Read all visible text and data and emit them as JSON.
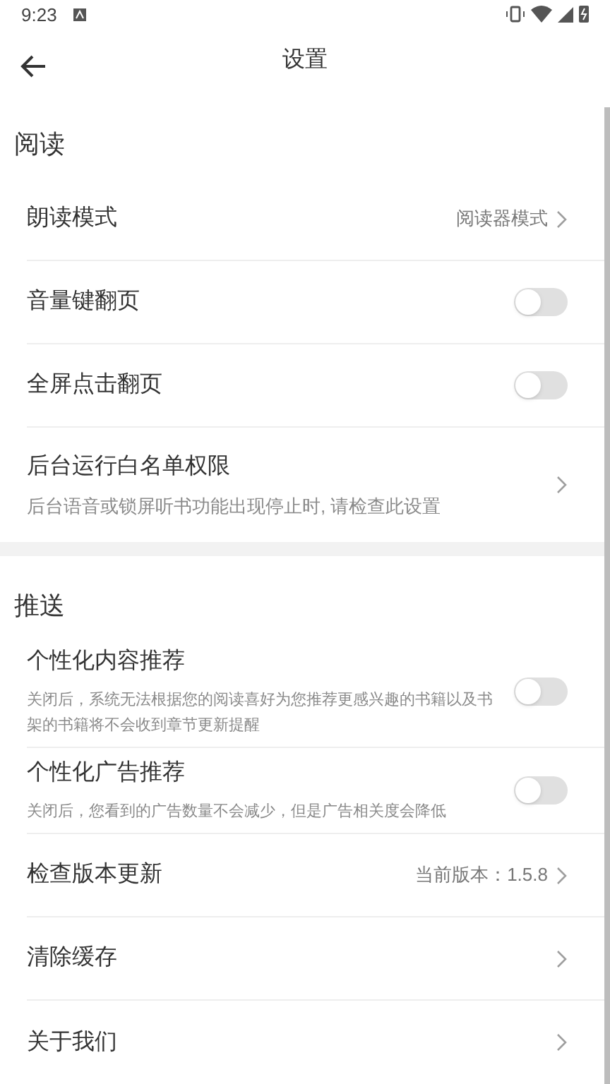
{
  "status_bar": {
    "time": "9:23"
  },
  "header": {
    "title": "设置"
  },
  "sections": [
    {
      "title": "阅读",
      "items": [
        {
          "kind": "link",
          "label": "朗读模式",
          "value": "阅读器模式"
        },
        {
          "kind": "toggle",
          "label": "音量键翻页",
          "on": false
        },
        {
          "kind": "toggle",
          "label": "全屏点击翻页",
          "on": false
        },
        {
          "kind": "link",
          "label": "后台运行白名单权限",
          "description": "后台语音或锁屏听书功能出现停止时, 请检查此设置"
        }
      ]
    },
    {
      "title": "推送",
      "items": [
        {
          "kind": "toggle",
          "label": "个性化内容推荐",
          "description": "关闭后，系统无法根据您的阅读喜好为您推荐更感兴趣的书籍以及书架的书籍将不会收到章节更新提醒",
          "on": false
        },
        {
          "kind": "toggle",
          "label": "个性化广告推荐",
          "description": "关闭后，您看到的广告数量不会减少，但是广告相关度会降低",
          "on": false
        },
        {
          "kind": "link",
          "label": "检查版本更新",
          "value": "当前版本：1.5.8"
        },
        {
          "kind": "link",
          "label": "清除缓存"
        },
        {
          "kind": "link",
          "label": "关于我们"
        }
      ]
    }
  ]
}
